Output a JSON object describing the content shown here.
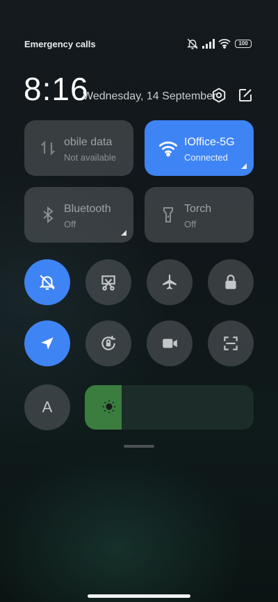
{
  "status_bar": {
    "carrier_text": "Emergency calls o",
    "battery_level": "100",
    "icons": [
      "mute-alert-icon",
      "signal-icon",
      "wifi-icon",
      "battery-icon"
    ]
  },
  "header": {
    "time": "8:16",
    "date": "Wednesday, 14 September",
    "settings_icon": "gear-icon",
    "edit_icon": "edit-icon"
  },
  "tiles": [
    {
      "title": "obile data",
      "subtitle": "Not available",
      "icon": "mobile-data-icon",
      "active": false
    },
    {
      "title": "IOffice-5G",
      "subtitle": "Connected",
      "icon": "wifi-icon",
      "active": true
    },
    {
      "title": "Bluetooth",
      "subtitle": "Off",
      "icon": "bluetooth-icon",
      "active": false
    },
    {
      "title": "Torch",
      "subtitle": "Off",
      "icon": "torch-icon",
      "active": false
    }
  ],
  "toggles_row1": [
    {
      "icon": "bell-off-icon",
      "active": true
    },
    {
      "icon": "screenshot-icon",
      "active": false
    },
    {
      "icon": "airplane-icon",
      "active": false
    },
    {
      "icon": "lock-icon",
      "active": false
    }
  ],
  "toggles_row2": [
    {
      "icon": "location-icon",
      "active": true
    },
    {
      "icon": "rotation-lock-icon",
      "active": false
    },
    {
      "icon": "video-camera-icon",
      "active": false
    },
    {
      "icon": "scan-icon",
      "active": false
    }
  ],
  "auto_brightness_label": "A",
  "brightness": {
    "level": 0.22,
    "icon": "sun-icon",
    "colors": {
      "fill": "#3a7d3f",
      "active": "#3f84f4"
    }
  }
}
